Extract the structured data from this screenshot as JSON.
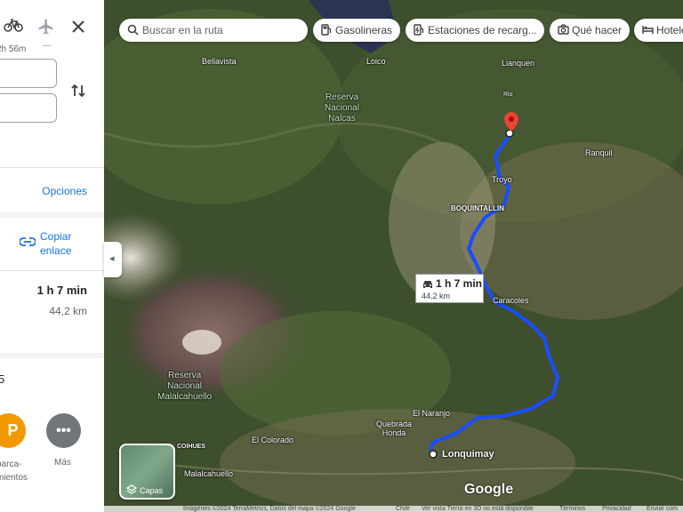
{
  "panel": {
    "bike_time": "2h 56m",
    "flight_dash": "—",
    "options_label": "Opciones",
    "copy_link_label": "Copiar enlace",
    "route_time": "1 h 7 min",
    "route_distance": "44,2 km",
    "partial_number": "5",
    "parking_letter": "P",
    "parking_label": "parca-\nmientos",
    "more_symbol": "•••",
    "more_label": "Más"
  },
  "map": {
    "search_placeholder": "Buscar en la ruta",
    "chips": [
      "Gasolineras",
      "Estaciones de recarg...",
      "Qué hacer",
      "Hoteles"
    ],
    "places": {
      "bellavista": "Bellavista",
      "loico": "Loico",
      "lianquen": "Lianquen",
      "reserva_nalcas": "Reserva\nNacional\nNalcas",
      "rio": "Rio",
      "ranquil": "Ranquil",
      "troyo": "Troyo",
      "boquintallin": "BOQUINTALLIN",
      "caracoles": "Caracoles",
      "reserva_malalcahuello": "Reserva\nNacional\nMalalcahuello",
      "el_naranjo": "El Naranjo",
      "quebrada_honda": "Quebrada\nHonda",
      "el_colorado": "El Colorado",
      "coihues": "COIHUES",
      "malalcahuello": "Malalcahuello",
      "lonquimay": "Lonquimay"
    },
    "route_box": {
      "time": "1 h 7 min",
      "distance": "44,2 km"
    },
    "layers_label": "Capas",
    "logo": "Google",
    "footer": [
      "Imágenes ©2024 TerraMetrics, Datos del mapa ©2024 Google",
      "Chile",
      "Ver vista Tierra en 3D no está disponible",
      "Términos",
      "Privacidad",
      "Enviar com"
    ],
    "route_color": "#1a4dff",
    "destination_color": "#ea4335"
  }
}
